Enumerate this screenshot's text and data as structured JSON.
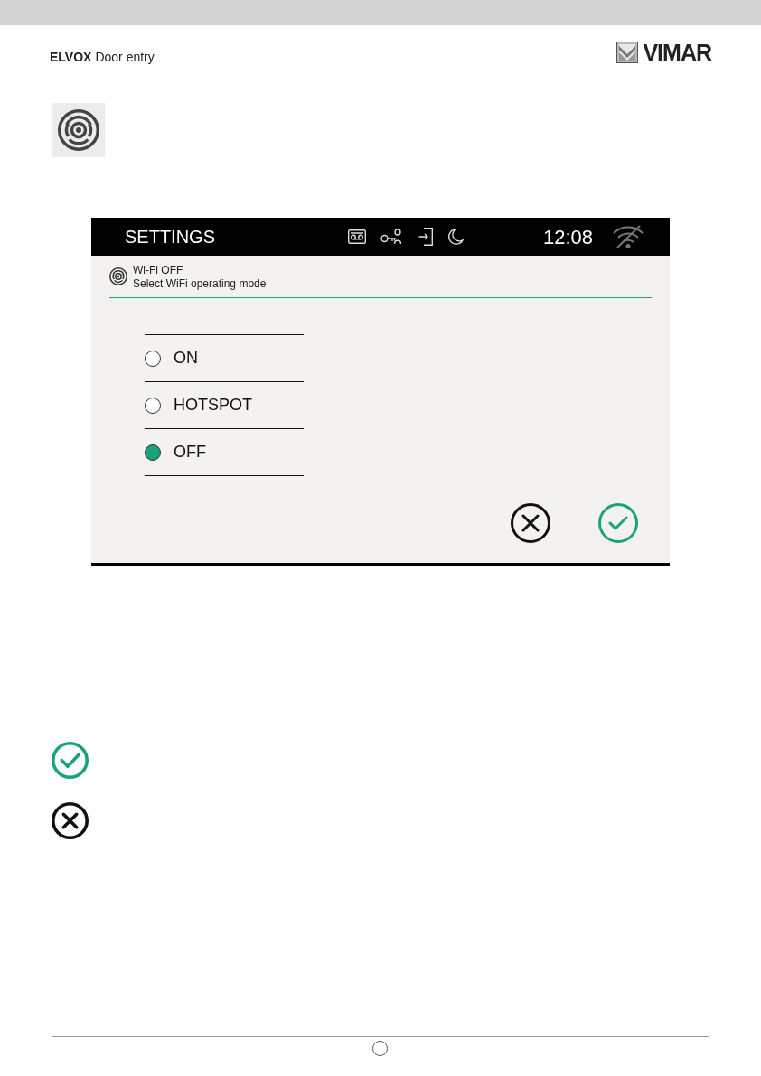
{
  "document_header": {
    "brand": "ELVOX",
    "product": "Door entry",
    "logo": "VIMAR"
  },
  "device_screen": {
    "title": "SETTINGS",
    "time": "12:08",
    "panel": {
      "title": "Wi-Fi OFF",
      "subtitle": "Select WiFi operating mode"
    },
    "options": [
      {
        "label": "ON",
        "selected": false
      },
      {
        "label": "HOTSPOT",
        "selected": false
      },
      {
        "label": "OFF",
        "selected": true
      }
    ]
  }
}
